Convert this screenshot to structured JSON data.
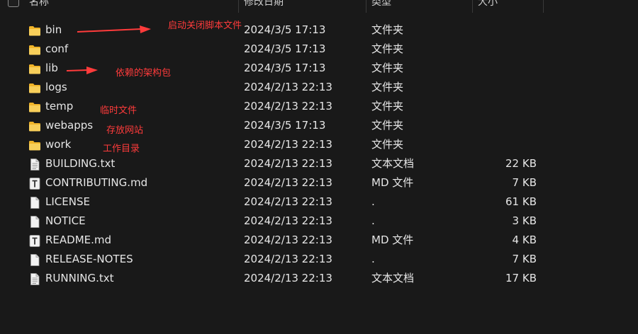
{
  "header": {
    "name": "名称",
    "date": "修改日期",
    "type": "类型",
    "size": "大小"
  },
  "files": [
    {
      "name": "bin",
      "date": "2024/3/5 17:13",
      "type": "文件夹",
      "size": "",
      "icon": "folder-icon"
    },
    {
      "name": "conf",
      "date": "2024/3/5 17:13",
      "type": "文件夹",
      "size": "",
      "icon": "folder-icon"
    },
    {
      "name": "lib",
      "date": "2024/3/5 17:13",
      "type": "文件夹",
      "size": "",
      "icon": "folder-icon"
    },
    {
      "name": "logs",
      "date": "2024/2/13 22:13",
      "type": "文件夹",
      "size": "",
      "icon": "folder-icon"
    },
    {
      "name": "temp",
      "date": "2024/2/13 22:13",
      "type": "文件夹",
      "size": "",
      "icon": "folder-icon"
    },
    {
      "name": "webapps",
      "date": "2024/3/5 17:13",
      "type": "文件夹",
      "size": "",
      "icon": "folder-icon"
    },
    {
      "name": "work",
      "date": "2024/2/13 22:13",
      "type": "文件夹",
      "size": "",
      "icon": "folder-icon"
    },
    {
      "name": "BUILDING.txt",
      "date": "2024/2/13 22:13",
      "type": "文本文档",
      "size": "22 KB",
      "icon": "text-file-icon"
    },
    {
      "name": "CONTRIBUTING.md",
      "date": "2024/2/13 22:13",
      "type": "MD 文件",
      "size": "7 KB",
      "icon": "markdown-file-icon"
    },
    {
      "name": "LICENSE",
      "date": "2024/2/13 22:13",
      "type": ".",
      "size": "61 KB",
      "icon": "file-icon"
    },
    {
      "name": "NOTICE",
      "date": "2024/2/13 22:13",
      "type": ".",
      "size": "3 KB",
      "icon": "file-icon"
    },
    {
      "name": "README.md",
      "date": "2024/2/13 22:13",
      "type": "MD 文件",
      "size": "4 KB",
      "icon": "markdown-file-icon"
    },
    {
      "name": "RELEASE-NOTES",
      "date": "2024/2/13 22:13",
      "type": ".",
      "size": "7 KB",
      "icon": "file-icon"
    },
    {
      "name": "RUNNING.txt",
      "date": "2024/2/13 22:13",
      "type": "文本文档",
      "size": "17 KB",
      "icon": "text-file-icon"
    }
  ],
  "annotations": {
    "bin": "启动关闭脚本文件",
    "lib": "依赖的架构包",
    "temp": "临时文件",
    "webapps": "存放网站",
    "work": "工作目录"
  },
  "colors": {
    "background": "#191919",
    "annotation": "#ff3b3b",
    "folder": "#f5c542"
  }
}
